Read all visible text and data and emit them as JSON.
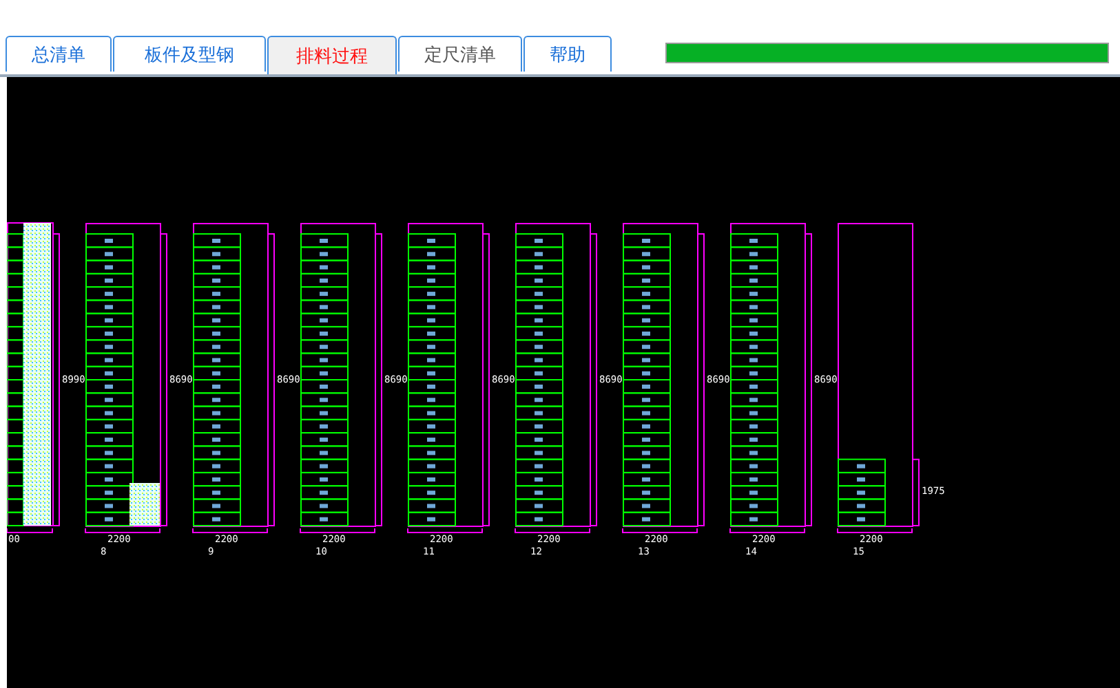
{
  "tabs": [
    {
      "label": "总清单",
      "selected": false,
      "disabled": false
    },
    {
      "label": "板件及型钢",
      "selected": false,
      "disabled": false
    },
    {
      "label": "排料过程",
      "selected": true,
      "disabled": false
    },
    {
      "label": "定尺清单",
      "selected": false,
      "disabled": true
    },
    {
      "label": "帮助",
      "selected": false,
      "disabled": false
    }
  ],
  "progress": {
    "level": 1
  },
  "sheets": [
    {
      "kind": "partial",
      "width_label": "00",
      "height_label": "8990",
      "pieces": [
        {
          "kind": "strip"
        },
        {
          "kind": "strip"
        },
        {
          "kind": "strip"
        },
        {
          "kind": "strip"
        },
        {
          "kind": "strip"
        },
        {
          "kind": "strip"
        },
        {
          "kind": "strip"
        },
        {
          "kind": "strip"
        },
        {
          "kind": "strip"
        },
        {
          "kind": "strip"
        },
        {
          "kind": "strip"
        },
        {
          "kind": "strip"
        },
        {
          "kind": "strip"
        },
        {
          "kind": "strip"
        },
        {
          "kind": "strip"
        },
        {
          "kind": "strip"
        },
        {
          "kind": "strip"
        },
        {
          "kind": "strip"
        },
        {
          "kind": "strip"
        },
        {
          "kind": "strip"
        },
        {
          "kind": "strip"
        },
        {
          "kind": "strip"
        },
        {
          "kind": "offcut"
        }
      ]
    },
    {
      "kind": "full",
      "number": "8",
      "width_label": "2200",
      "height_label": "8690",
      "pieces": [
        {
          "kind": "strip"
        },
        {
          "kind": "strip"
        },
        {
          "kind": "strip"
        },
        {
          "kind": "strip"
        },
        {
          "kind": "strip"
        },
        {
          "kind": "strip"
        },
        {
          "kind": "strip"
        },
        {
          "kind": "strip"
        },
        {
          "kind": "strip"
        },
        {
          "kind": "strip"
        },
        {
          "kind": "strip"
        },
        {
          "kind": "strip"
        },
        {
          "kind": "strip"
        },
        {
          "kind": "strip"
        },
        {
          "kind": "strip"
        },
        {
          "kind": "strip"
        },
        {
          "kind": "strip"
        },
        {
          "kind": "strip"
        },
        {
          "kind": "strip"
        },
        {
          "kind": "strip"
        },
        {
          "kind": "strip"
        },
        {
          "kind": "strip"
        },
        {
          "kind": "offcut"
        }
      ]
    },
    {
      "kind": "full",
      "number": "9",
      "width_label": "2200",
      "height_label": "8690",
      "pieces": [
        {
          "kind": "strip"
        },
        {
          "kind": "strip"
        },
        {
          "kind": "strip"
        },
        {
          "kind": "strip"
        },
        {
          "kind": "strip"
        },
        {
          "kind": "strip"
        },
        {
          "kind": "strip"
        },
        {
          "kind": "strip"
        },
        {
          "kind": "strip"
        },
        {
          "kind": "strip"
        },
        {
          "kind": "strip"
        },
        {
          "kind": "strip"
        },
        {
          "kind": "strip"
        },
        {
          "kind": "strip"
        },
        {
          "kind": "strip"
        },
        {
          "kind": "strip"
        },
        {
          "kind": "strip"
        },
        {
          "kind": "strip"
        },
        {
          "kind": "strip"
        },
        {
          "kind": "strip"
        },
        {
          "kind": "strip"
        },
        {
          "kind": "strip"
        }
      ]
    },
    {
      "kind": "full",
      "number": "10",
      "width_label": "2200",
      "height_label": "8690",
      "pieces": [
        {
          "kind": "strip"
        },
        {
          "kind": "strip"
        },
        {
          "kind": "strip"
        },
        {
          "kind": "strip"
        },
        {
          "kind": "strip"
        },
        {
          "kind": "strip"
        },
        {
          "kind": "strip"
        },
        {
          "kind": "strip"
        },
        {
          "kind": "strip"
        },
        {
          "kind": "strip"
        },
        {
          "kind": "strip"
        },
        {
          "kind": "strip"
        },
        {
          "kind": "strip"
        },
        {
          "kind": "strip"
        },
        {
          "kind": "strip"
        },
        {
          "kind": "strip"
        },
        {
          "kind": "strip"
        },
        {
          "kind": "strip"
        },
        {
          "kind": "strip"
        },
        {
          "kind": "strip"
        },
        {
          "kind": "strip"
        },
        {
          "kind": "strip"
        }
      ]
    },
    {
      "kind": "full",
      "number": "11",
      "width_label": "2200",
      "height_label": "8690",
      "pieces": [
        {
          "kind": "strip"
        },
        {
          "kind": "strip"
        },
        {
          "kind": "strip"
        },
        {
          "kind": "strip"
        },
        {
          "kind": "strip"
        },
        {
          "kind": "strip"
        },
        {
          "kind": "strip"
        },
        {
          "kind": "strip"
        },
        {
          "kind": "strip"
        },
        {
          "kind": "strip"
        },
        {
          "kind": "strip"
        },
        {
          "kind": "strip"
        },
        {
          "kind": "strip"
        },
        {
          "kind": "strip"
        },
        {
          "kind": "strip"
        },
        {
          "kind": "strip"
        },
        {
          "kind": "strip"
        },
        {
          "kind": "strip"
        },
        {
          "kind": "strip"
        },
        {
          "kind": "strip"
        },
        {
          "kind": "strip"
        },
        {
          "kind": "strip"
        }
      ]
    },
    {
      "kind": "full",
      "number": "12",
      "width_label": "2200",
      "height_label": "8690",
      "pieces": [
        {
          "kind": "strip"
        },
        {
          "kind": "strip"
        },
        {
          "kind": "strip"
        },
        {
          "kind": "strip"
        },
        {
          "kind": "strip"
        },
        {
          "kind": "strip"
        },
        {
          "kind": "strip"
        },
        {
          "kind": "strip"
        },
        {
          "kind": "strip"
        },
        {
          "kind": "strip"
        },
        {
          "kind": "strip"
        },
        {
          "kind": "strip"
        },
        {
          "kind": "strip"
        },
        {
          "kind": "strip"
        },
        {
          "kind": "strip"
        },
        {
          "kind": "strip"
        },
        {
          "kind": "strip"
        },
        {
          "kind": "strip"
        },
        {
          "kind": "strip"
        },
        {
          "kind": "strip"
        },
        {
          "kind": "strip"
        },
        {
          "kind": "strip"
        }
      ]
    },
    {
      "kind": "full",
      "number": "13",
      "width_label": "2200",
      "height_label": "8690",
      "pieces": [
        {
          "kind": "strip"
        },
        {
          "kind": "strip"
        },
        {
          "kind": "strip"
        },
        {
          "kind": "strip"
        },
        {
          "kind": "strip"
        },
        {
          "kind": "strip"
        },
        {
          "kind": "strip"
        },
        {
          "kind": "strip"
        },
        {
          "kind": "strip"
        },
        {
          "kind": "strip"
        },
        {
          "kind": "strip"
        },
        {
          "kind": "strip"
        },
        {
          "kind": "strip"
        },
        {
          "kind": "strip"
        },
        {
          "kind": "strip"
        },
        {
          "kind": "strip"
        },
        {
          "kind": "strip"
        },
        {
          "kind": "strip"
        },
        {
          "kind": "strip"
        },
        {
          "kind": "strip"
        },
        {
          "kind": "strip"
        },
        {
          "kind": "strip"
        }
      ]
    },
    {
      "kind": "full",
      "number": "14",
      "width_label": "2200",
      "height_label": "8690",
      "pieces": [
        {
          "kind": "strip"
        },
        {
          "kind": "strip"
        },
        {
          "kind": "strip"
        },
        {
          "kind": "strip"
        },
        {
          "kind": "strip"
        },
        {
          "kind": "strip"
        },
        {
          "kind": "strip"
        },
        {
          "kind": "strip"
        },
        {
          "kind": "strip"
        },
        {
          "kind": "strip"
        },
        {
          "kind": "strip"
        },
        {
          "kind": "strip"
        },
        {
          "kind": "strip"
        },
        {
          "kind": "strip"
        },
        {
          "kind": "strip"
        },
        {
          "kind": "strip"
        },
        {
          "kind": "strip"
        },
        {
          "kind": "strip"
        },
        {
          "kind": "strip"
        },
        {
          "kind": "strip"
        },
        {
          "kind": "strip"
        },
        {
          "kind": "strip"
        }
      ]
    },
    {
      "kind": "full",
      "number": "15",
      "width_label": "2200",
      "height_label": "1975",
      "pieces": [
        {
          "kind": "strip"
        },
        {
          "kind": "strip"
        },
        {
          "kind": "strip"
        },
        {
          "kind": "strip"
        },
        {
          "kind": "strip"
        }
      ]
    }
  ]
}
